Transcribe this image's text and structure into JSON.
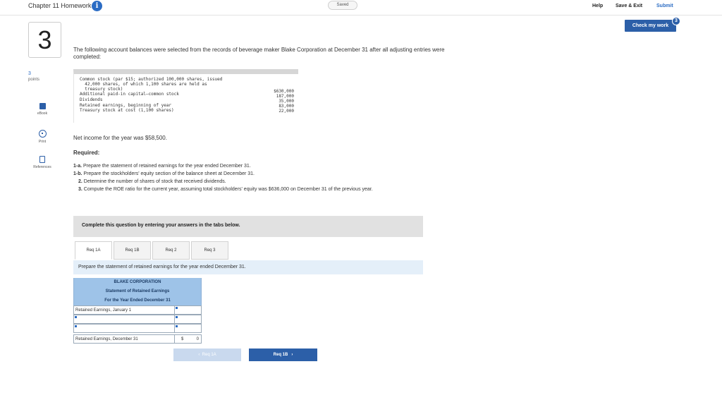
{
  "header": {
    "title": "Chapter 11 Homework",
    "saved_label": "Saved",
    "help": "Help",
    "save_exit": "Save & Exit",
    "submit": "Submit",
    "info_icon": "info-icon"
  },
  "check_work": {
    "label": "Check my work",
    "badge": "3"
  },
  "question": {
    "number": "3",
    "points_value": "3",
    "points_label": "points"
  },
  "side_tools": {
    "ebook": "eBook",
    "print": "Print",
    "references": "References"
  },
  "intro": "The following account balances were selected from the records of beverage maker Blake Corporation at December 31 after all adjusting entries were completed:",
  "accounts": [
    {
      "line1": "Common stock (par $15; authorized 100,000 shares, issued",
      "line2": "  42,000 shares, of which 1,100 shares are held as",
      "line3": "  treasury stock)",
      "value": "$630,000"
    },
    {
      "line1": "Additional paid-in capital—common stock",
      "value": "187,000"
    },
    {
      "line1": "Dividends",
      "value": "35,000"
    },
    {
      "line1": "Retained earnings, beginning of year",
      "value": "83,000"
    },
    {
      "line1": "Treasury stock at cost (1,100 shares)",
      "value": "22,000"
    }
  ],
  "net_income": "Net income for the year was $58,500.",
  "required_label": "Required:",
  "requirements": [
    {
      "id": "1-a.",
      "text": "Prepare the statement of retained earnings for the year ended December 31."
    },
    {
      "id": "1-b.",
      "text": "Prepare the stockholders' equity section of the balance sheet at December 31."
    },
    {
      "id": "2.",
      "text": "Determine the number of shares of stock that received dividends."
    },
    {
      "id": "3.",
      "text": "Compute the ROE ratio for the current year, assuming total stockholders' equity was $636,000 on December 31 of the previous year."
    }
  ],
  "complete_banner": "Complete this question by entering your answers in the tabs below.",
  "tabs": [
    "Req 1A",
    "Req 1B",
    "Req 2",
    "Req 3"
  ],
  "prepare_text": "Prepare the statement of retained earnings for the year ended December 31.",
  "statement": {
    "company": "BLAKE CORPORATION",
    "name": "Statement of Retained Earnings",
    "period": "For the Year Ended December 31",
    "row_begin": "Retained Earnings, January 1",
    "row_end": "Retained Earnings, December 31",
    "dollar": "$",
    "end_value": "0"
  },
  "nav": {
    "prev": "Req 1A",
    "next": "Req 1B"
  },
  "colors": {
    "accent": "#2c5fa8",
    "header_blue": "#9ec3e8"
  }
}
